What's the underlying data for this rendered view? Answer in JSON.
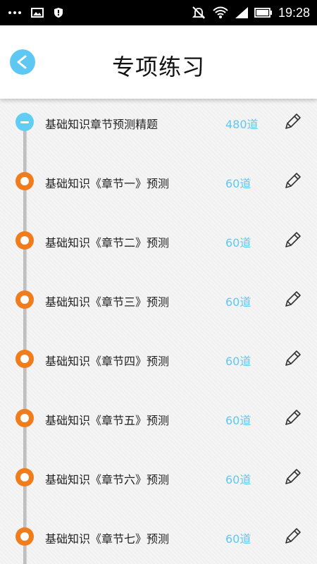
{
  "status_bar": {
    "time": "19:28",
    "left_icons": [
      "more-dots-icon",
      "image-icon",
      "shield-alert-icon"
    ],
    "right_icons": [
      "mute-icon",
      "wifi-icon",
      "signal-icon",
      "battery-icon"
    ]
  },
  "header": {
    "back_icon": "back-arrow-icon",
    "title": "专项练习"
  },
  "colors": {
    "accent_blue": "#5ec8f2",
    "node_orange": "#f17c1b"
  },
  "items": [
    {
      "label": "基础知识章节预测精题",
      "count": "480道",
      "state": "expanded",
      "icon": "pencil-icon"
    },
    {
      "label": "基础知识《章节一》预测",
      "count": "60道",
      "state": "collapsed",
      "icon": "pencil-icon"
    },
    {
      "label": "基础知识《章节二》预测",
      "count": "60道",
      "state": "collapsed",
      "icon": "pencil-icon"
    },
    {
      "label": "基础知识《章节三》预测",
      "count": "60道",
      "state": "collapsed",
      "icon": "pencil-icon"
    },
    {
      "label": "基础知识《章节四》预测",
      "count": "60道",
      "state": "collapsed",
      "icon": "pencil-icon"
    },
    {
      "label": "基础知识《章节五》预测",
      "count": "60道",
      "state": "collapsed",
      "icon": "pencil-icon"
    },
    {
      "label": "基础知识《章节六》预测",
      "count": "60道",
      "state": "collapsed",
      "icon": "pencil-icon"
    },
    {
      "label": "基础知识《章节七》预测",
      "count": "60道",
      "state": "collapsed",
      "icon": "pencil-icon"
    }
  ]
}
